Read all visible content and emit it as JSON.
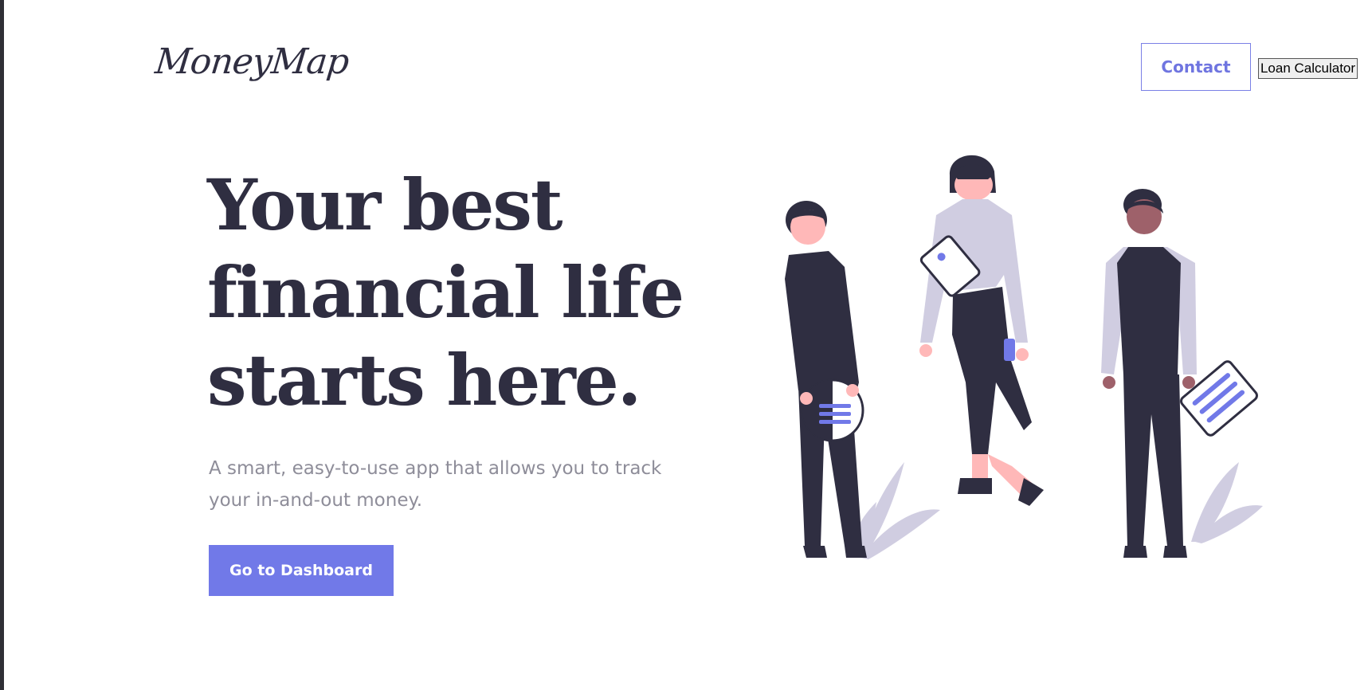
{
  "header": {
    "logo_text": "MoneyMap",
    "contact_label": "Contact",
    "loan_calculator_label": "Loan Calculator"
  },
  "hero": {
    "headline_line1": "Your best",
    "headline_line2": "financial life",
    "headline_line3": "starts here.",
    "subtitle_line1": "A smart, easy-to-use app that allows you to track",
    "subtitle_line2": "your in-and-out money.",
    "cta_label": "Go to Dashboard"
  },
  "colors": {
    "accent": "#7179e8",
    "text_dark": "#2f2e41",
    "text_muted": "#8e8d99",
    "illustration_light": "#d0cde1",
    "skin_light": "#ffb8b8",
    "skin_dark": "#9e616a"
  },
  "illustration": {
    "icon": "people-illustration"
  }
}
